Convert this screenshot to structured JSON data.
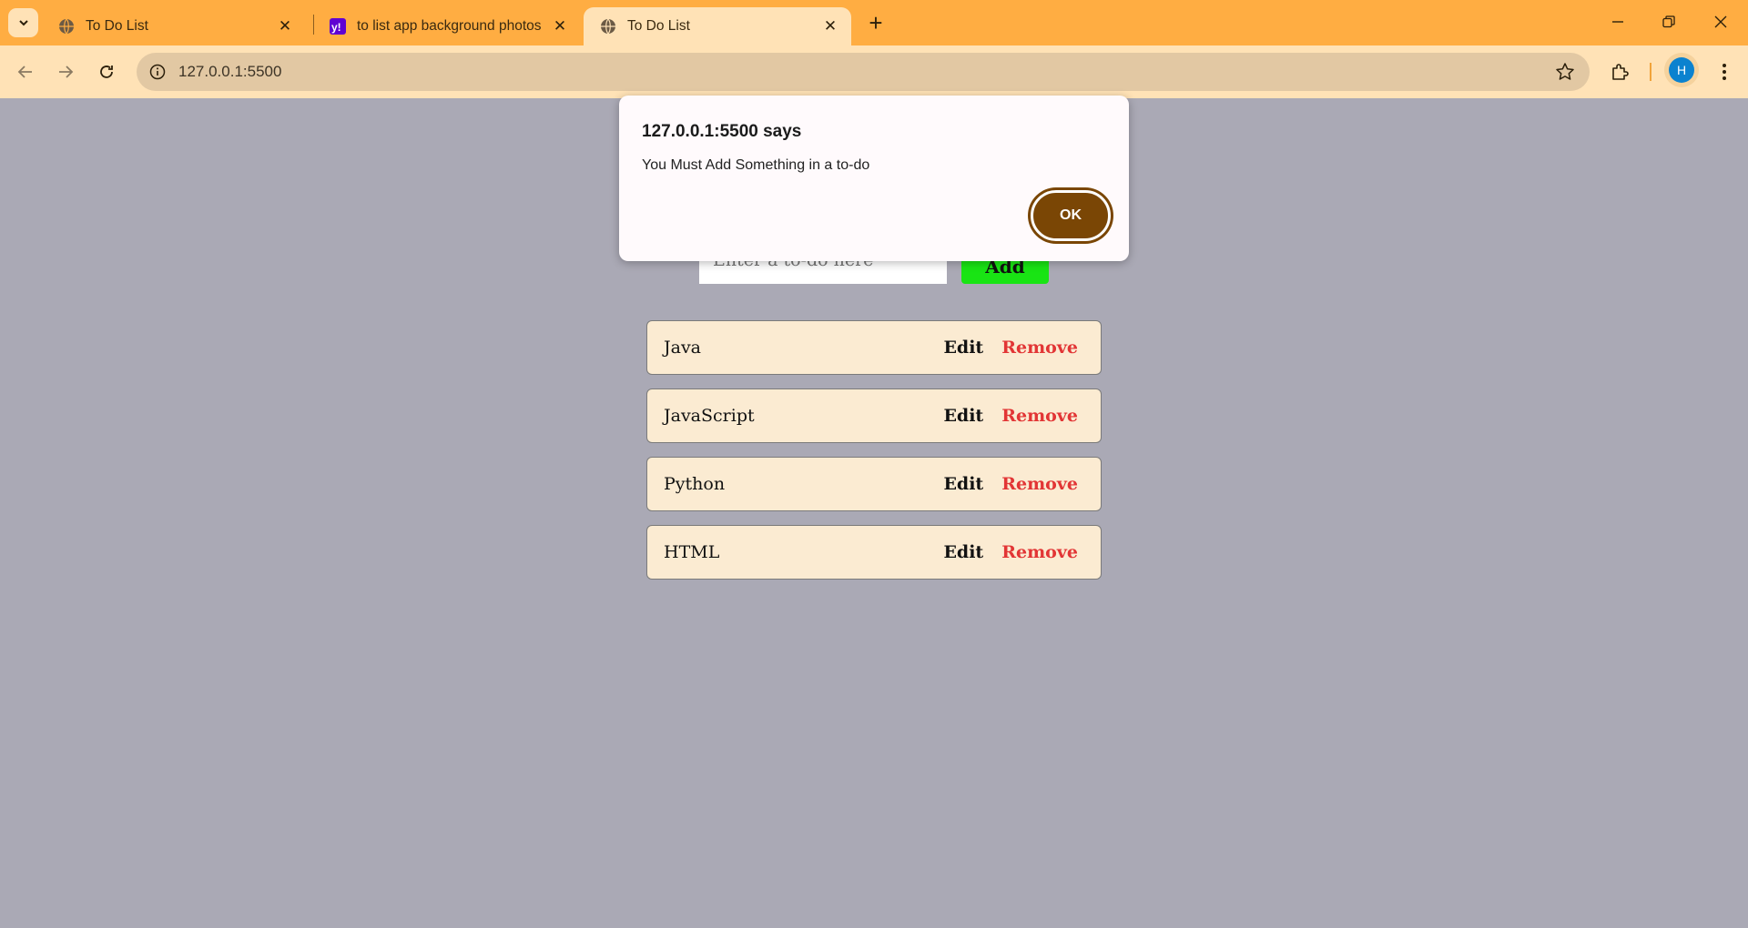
{
  "browser": {
    "tabs": [
      {
        "title": "To Do List",
        "active": false
      },
      {
        "title": "to list app background photos",
        "active": false
      },
      {
        "title": "To Do List",
        "active": true
      }
    ],
    "address": "127.0.0.1:5500",
    "profile_initial": "H",
    "colors": {
      "tabbar": "#ffad42",
      "toolbar": "#ffe2b6",
      "omnibox": "#e2c8a3",
      "avatar": "#0b82cf"
    }
  },
  "page": {
    "input_placeholder": "Enter a to-do here",
    "add_label": "Add",
    "items": [
      {
        "name": "Java",
        "edit": "Edit",
        "remove": "Remove"
      },
      {
        "name": "JavaScript",
        "edit": "Edit",
        "remove": "Remove"
      },
      {
        "name": "Python",
        "edit": "Edit",
        "remove": "Remove"
      },
      {
        "name": "HTML",
        "edit": "Edit",
        "remove": "Remove"
      }
    ],
    "colors": {
      "background": "#aaa9b5",
      "item": "#fbebd2",
      "remove": "#e23535",
      "add": "#19e414"
    }
  },
  "dialog": {
    "title": "127.0.0.1:5500 says",
    "message": "You Must Add Something in a to-do",
    "ok_label": "OK",
    "colors": {
      "ok": "#7a4605"
    }
  }
}
